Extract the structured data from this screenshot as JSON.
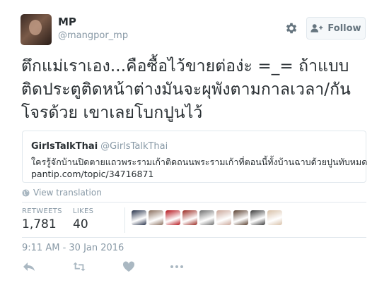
{
  "author": {
    "name": "MP",
    "handle": "@mangpor_mp"
  },
  "follow_label": "Follow",
  "tweet_lines": [
    "ตึกแม่เราเอง...คือซื้อไว้ขายต่อง่ะ =_= ถ้าแบบ",
    "ติดประตูติดหน้าต่างมันจะผุพังตามกาลเวลา/กัน",
    "โจรด้วย เขาเลยโบกปูนไว้"
  ],
  "quoted": {
    "name": "GirlsTalkThai",
    "handle": "@GirlsTalkThai",
    "text": "ใครรู้จักบ้านปิดตายแถวพระรามเก้าติดถนนพระรามเก้าที่ตอนนี้ทั้งบ้านฉาบด้วยปูนทับหมด",
    "link": "pantip.com/topic/34716871"
  },
  "translate_label": "View translation",
  "stats": {
    "retweets_label": "RETWEETS",
    "retweets_value": "1,781",
    "likes_label": "LIKES",
    "likes_value": "40"
  },
  "liker_colors": [
    "#27324a",
    "#8a6f5e",
    "#b5141b",
    "#9a2a22",
    "#6f6f6f",
    "#caa79a",
    "#5a4030",
    "#3b3b3b",
    "#d8c0a8"
  ],
  "timestamp": "9:11 AM - 30 Jan 2016",
  "icons": [
    "gear-icon",
    "follow-person-icon",
    "globe-icon",
    "reply-icon",
    "retweet-icon",
    "like-icon",
    "more-icon"
  ],
  "colors": {
    "text": "#292f33",
    "muted": "#8899a6",
    "border": "#e1e8ed",
    "icon": "#aab8c2"
  }
}
